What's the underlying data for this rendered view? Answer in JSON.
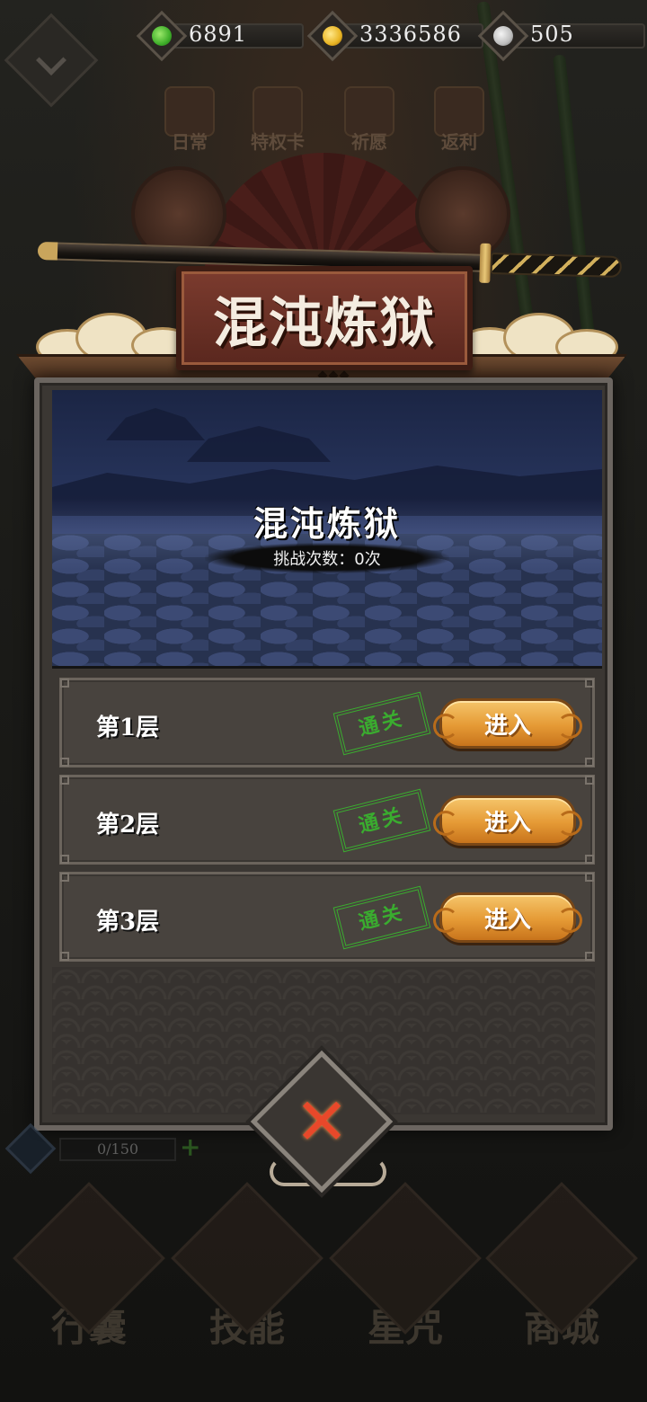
{
  "currencies": [
    {
      "icon": "jade-drop-icon",
      "value": "6891",
      "color": "#3fae2a"
    },
    {
      "icon": "gold-coin-icon",
      "value": "3336586",
      "color": "#e8b423"
    },
    {
      "icon": "silver-swirl-icon",
      "value": "505",
      "color": "#bdbdbd"
    }
  ],
  "background": {
    "top_menu": [
      "日常",
      "特权卡",
      "祈愿",
      "返利"
    ],
    "bottom_nav": [
      "行囊",
      "技能",
      "星咒",
      "商城"
    ],
    "energy": "0/150"
  },
  "modal": {
    "title": "混沌炼狱",
    "scene_title": "混沌炼狱",
    "challenge_count": "挑战次数：0次",
    "levels": [
      {
        "name": "第1层",
        "stamp": "通关",
        "button": "进入"
      },
      {
        "name": "第2层",
        "stamp": "通关",
        "button": "进入"
      },
      {
        "name": "第3层",
        "stamp": "通关",
        "button": "进入"
      }
    ],
    "close_symbol": "✕"
  },
  "colors": {
    "stamp": "#39b82e",
    "enter_button": "#e59a35",
    "title_board": "#6a3025",
    "close_x": "#e8482a"
  }
}
